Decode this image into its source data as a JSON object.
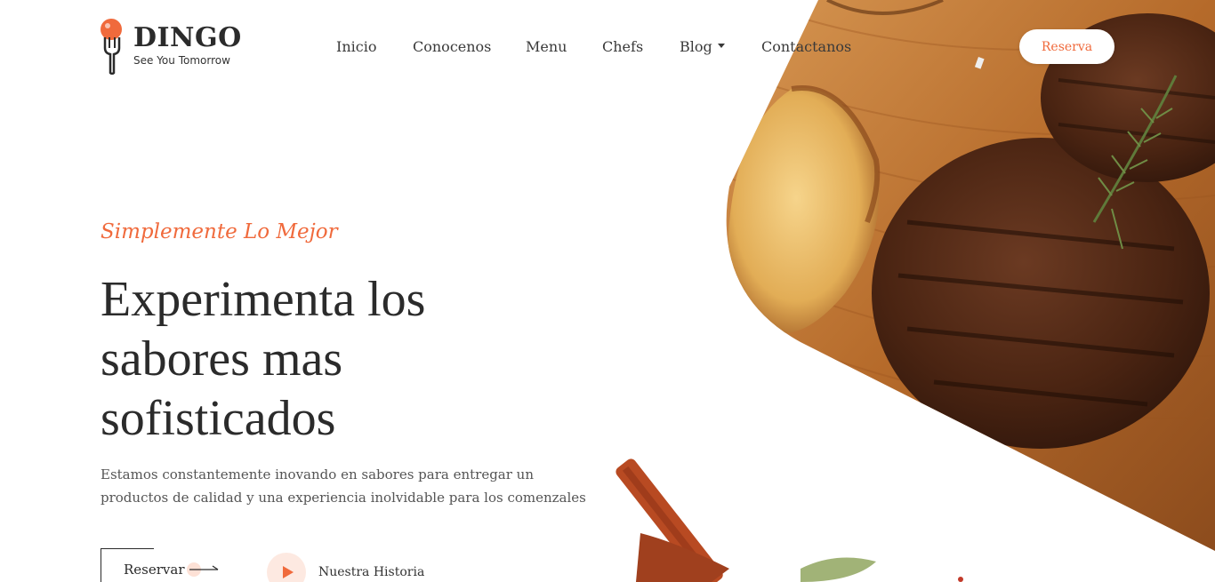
{
  "brand": {
    "name": "DINGO",
    "tagline": "See You Tomorrow"
  },
  "nav": {
    "items": [
      {
        "label": "Inicio"
      },
      {
        "label": "Conocenos"
      },
      {
        "label": "Menu"
      },
      {
        "label": "Chefs"
      },
      {
        "label": "Blog"
      },
      {
        "label": "Contactanos"
      }
    ],
    "cta_label": "Reserva"
  },
  "hero": {
    "eyebrow": "Simplemente Lo Mejor",
    "headline_line1": "Experimenta los",
    "headline_line2": "sabores mas",
    "headline_line3": "sofisticados",
    "description": "Estamos constantemente inovando en sabores para entregar un productos de calidad y una experiencia inolvidable para los comenzales",
    "primary_button": "Reservar",
    "secondary_button": "Nuestra Historia"
  },
  "colors": {
    "accent": "#f06a3c",
    "text": "#2b2b2b",
    "wood": "#b56a2a"
  },
  "icons": {
    "logo": "fork-with-orange-icon",
    "dropdown": "caret-down-icon",
    "arrow": "arrow-right-icon",
    "play": "play-icon"
  }
}
